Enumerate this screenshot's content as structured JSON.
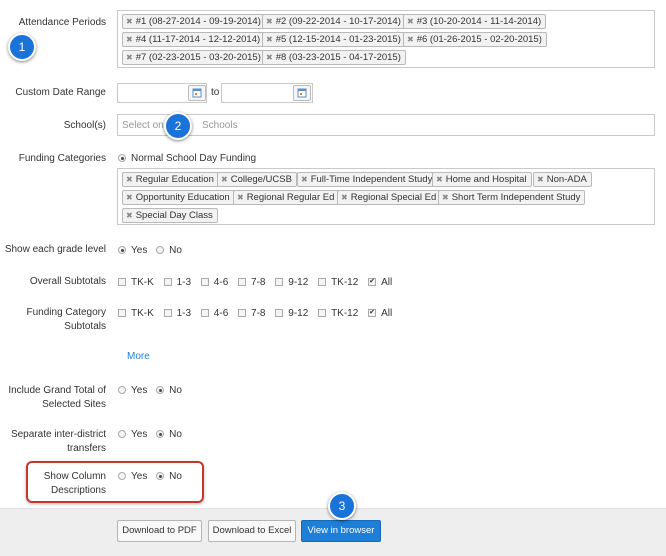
{
  "attendance": {
    "label": "Attendance Periods",
    "tags": [
      "#1 (08-27-2014 - 09-19-2014)",
      "#2 (09-22-2014 - 10-17-2014)",
      "#3 (10-20-2014 - 11-14-2014)",
      "#4 (11-17-2014 - 12-12-2014)",
      "#5 (12-15-2014 - 01-23-2015)",
      "#6 (01-26-2015 - 02-20-2015)",
      "#7 (02-23-2015 - 03-20-2015)",
      "#8 (03-23-2015 - 04-17-2015)"
    ]
  },
  "date_range": {
    "label": "Custom Date Range",
    "to": "to",
    "from_value": "",
    "to_value": ""
  },
  "schools": {
    "label": "School(s)",
    "placeholder": "Select one",
    "placeholder_tail": "Schools"
  },
  "funding": {
    "label": "Funding Categories",
    "radio_label": "Normal School Day Funding",
    "tags": [
      "Regular Education",
      "College/UCSB",
      "Full-Time Independent Study",
      "Home and Hospital",
      "Non-ADA",
      "Opportunity Education",
      "Regional Regular Ed",
      "Regional Special Ed",
      "Short Term Independent Study",
      "Special Day Class"
    ]
  },
  "grade_level": {
    "label": "Show each grade level",
    "yes": "Yes",
    "no": "No"
  },
  "overall": {
    "label": "Overall Subtotals",
    "options": [
      "TK-K",
      "1-3",
      "4-6",
      "7-8",
      "9-12",
      "TK-12",
      "All"
    ]
  },
  "funding_subtotals": {
    "label1": "Funding Category",
    "label2": "Subtotals",
    "options": [
      "TK-K",
      "1-3",
      "4-6",
      "7-8",
      "9-12",
      "TK-12",
      "All"
    ]
  },
  "more": "More",
  "grand_total": {
    "label1": "Include Grand Total of",
    "label2": "Selected Sites",
    "yes": "Yes",
    "no": "No"
  },
  "inter_district": {
    "label1": "Separate inter-district",
    "label2": "transfers",
    "yes": "Yes",
    "no": "No"
  },
  "column_desc": {
    "label1": "Show Column",
    "label2": "Descriptions",
    "yes": "Yes",
    "no": "No"
  },
  "buttons": {
    "pdf": "Download to PDF",
    "excel": "Download to Excel",
    "browser": "View in browser"
  },
  "badges": {
    "b1": "1",
    "b2": "2",
    "b3": "3"
  },
  "colors": {
    "accent": "#1d7fd8",
    "highlight": "#c0392b",
    "footer_bg": "#eeeeee"
  }
}
